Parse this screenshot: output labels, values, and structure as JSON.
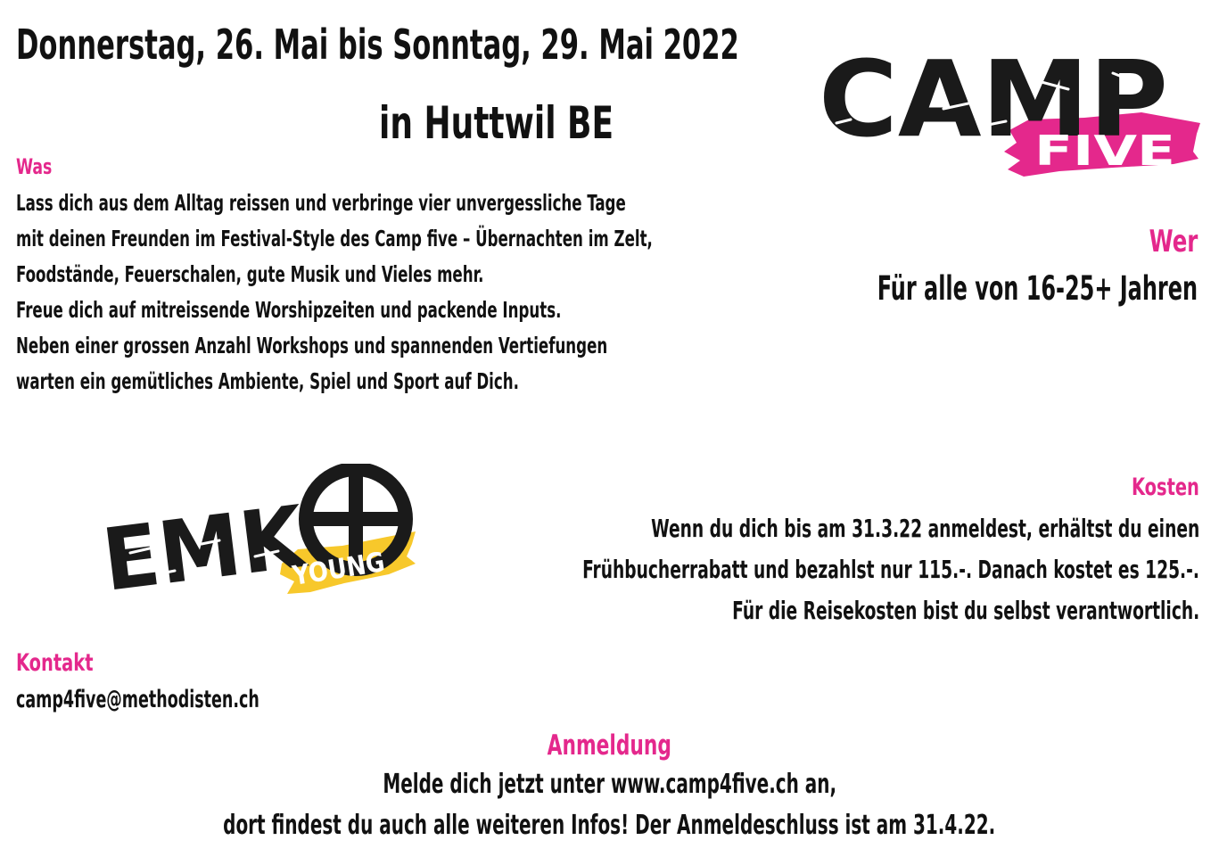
{
  "header": {
    "line1": "Donnerstag, 26. Mai bis Sonntag, 29. Mai 2022",
    "line2": "in Huttwil BE"
  },
  "was": {
    "heading": "Was",
    "lines": [
      "Lass dich aus dem Alltag reissen und verbringe vier unvergessliche Tage",
      "mit deinen Freunden im Festival-Style des Camp five – Übernachten im Zelt,",
      "Foodstände, Feuerschalen, gute Musik und Vieles mehr.",
      "Freue dich auf mitreissende Worshipzeiten und packende Inputs.",
      "Neben einer grossen Anzahl Workshops und spannenden Vertiefungen",
      "warten ein gemütliches Ambiente, Spiel und Sport auf Dich."
    ]
  },
  "camp_logo": {
    "word": "CAMP",
    "sub": "FIVE",
    "colors": {
      "main": "#1a1a1a",
      "accent": "#e4288c"
    }
  },
  "wer": {
    "heading": "Wer",
    "text": "Für alle von 16-25+ Jahren"
  },
  "emk_logo": {
    "word": "EMK",
    "sub": "YOUNG",
    "colors": {
      "main": "#1a1a1a",
      "accent": "#f7c82b"
    }
  },
  "kosten": {
    "heading": "Kosten",
    "lines": [
      "Wenn du dich bis am 31.3.22 anmeldest, erhältst du einen",
      "Frühbucherrabatt und bezahlst nur 115.-. Danach kostet es 125.-.",
      "Für die Reisekosten bist du selbst verantwortlich."
    ]
  },
  "kontakt": {
    "heading": "Kontakt",
    "email": "camp4five@methodisten.ch"
  },
  "anmeldung": {
    "heading": "Anmeldung",
    "lines": [
      "Melde dich jetzt unter www.camp4five.ch an,",
      "dort findest du auch alle weiteren Infos! Der Anmeldeschluss ist am 31.4.22."
    ]
  },
  "colors": {
    "accent": "#e4288c",
    "text": "#111111",
    "background": "#ffffff"
  }
}
